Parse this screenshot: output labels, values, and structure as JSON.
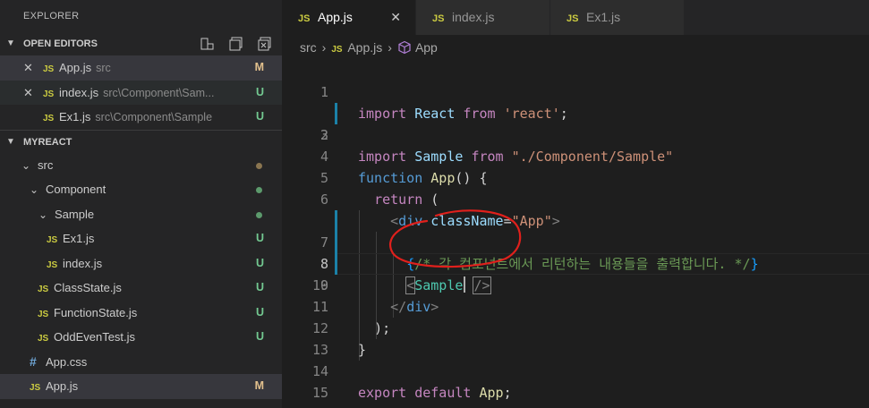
{
  "sidebar": {
    "title": "EXPLORER",
    "open_editors": {
      "header": "OPEN EDITORS",
      "items": [
        {
          "close": "✕",
          "icon": "JS",
          "name": "App.js",
          "path": "src",
          "badge": "M"
        },
        {
          "close": "✕",
          "icon": "JS",
          "name": "index.js",
          "path": "src\\Component\\Sam...",
          "badge": "U"
        },
        {
          "icon": "JS",
          "name": "Ex1.js",
          "path": "src\\Component\\Sample",
          "badge": "U"
        }
      ]
    },
    "project": {
      "header": "MYREACT",
      "items": [
        {
          "name": "src"
        },
        {
          "name": "Component"
        },
        {
          "name": "Sample"
        },
        {
          "icon": "JS",
          "name": "Ex1.js",
          "badge": "U"
        },
        {
          "icon": "JS",
          "name": "index.js",
          "badge": "U"
        },
        {
          "icon": "JS",
          "name": "ClassState.js",
          "badge": "U"
        },
        {
          "icon": "JS",
          "name": "FunctionState.js",
          "badge": "U"
        },
        {
          "icon": "JS",
          "name": "OddEvenTest.js",
          "badge": "U"
        },
        {
          "icon": "#",
          "name": "App.css"
        },
        {
          "icon": "JS",
          "name": "App.js",
          "badge": "M"
        }
      ]
    }
  },
  "tabs": [
    {
      "icon": "JS",
      "label": "App.js",
      "close": "✕"
    },
    {
      "icon": "JS",
      "label": "index.js"
    },
    {
      "icon": "JS",
      "label": "Ex1.js"
    }
  ],
  "breadcrumb": {
    "folder": "src",
    "sep": "›",
    "file_icon": "JS",
    "file": "App.js",
    "symbol": "App"
  },
  "code": {
    "line_numbers": [
      "1",
      "2",
      "3",
      "4",
      "5",
      "6",
      "7",
      "8",
      "9",
      "10",
      "11",
      "12",
      "13",
      "14",
      "15"
    ],
    "l1": [
      "import",
      "React",
      "from",
      "'react'",
      ";"
    ],
    "l2": [
      "import",
      "Sample",
      "from",
      "\"./Component/Sample\""
    ],
    "l4": [
      "function",
      "App",
      "() {"
    ],
    "l5": [
      "return",
      "("
    ],
    "l6": [
      "<",
      "div",
      "className",
      "=",
      "\"App\"",
      ">"
    ],
    "l7": [
      "{",
      "/* 각 컴포넌트에서 리턴하는 내용들을 출력합니다. */",
      "}"
    ],
    "l8": [
      "<",
      "Sample",
      "/>"
    ],
    "l10": [
      "</",
      "div",
      ">"
    ],
    "l11": [
      ");"
    ],
    "l12": [
      "}"
    ],
    "l14": [
      "export",
      "default",
      "App",
      ";"
    ]
  },
  "colors": {
    "annotation": "#e0201c",
    "modified": "#e2c08d",
    "untracked": "#73c991",
    "js_icon": "#cbcb41"
  }
}
